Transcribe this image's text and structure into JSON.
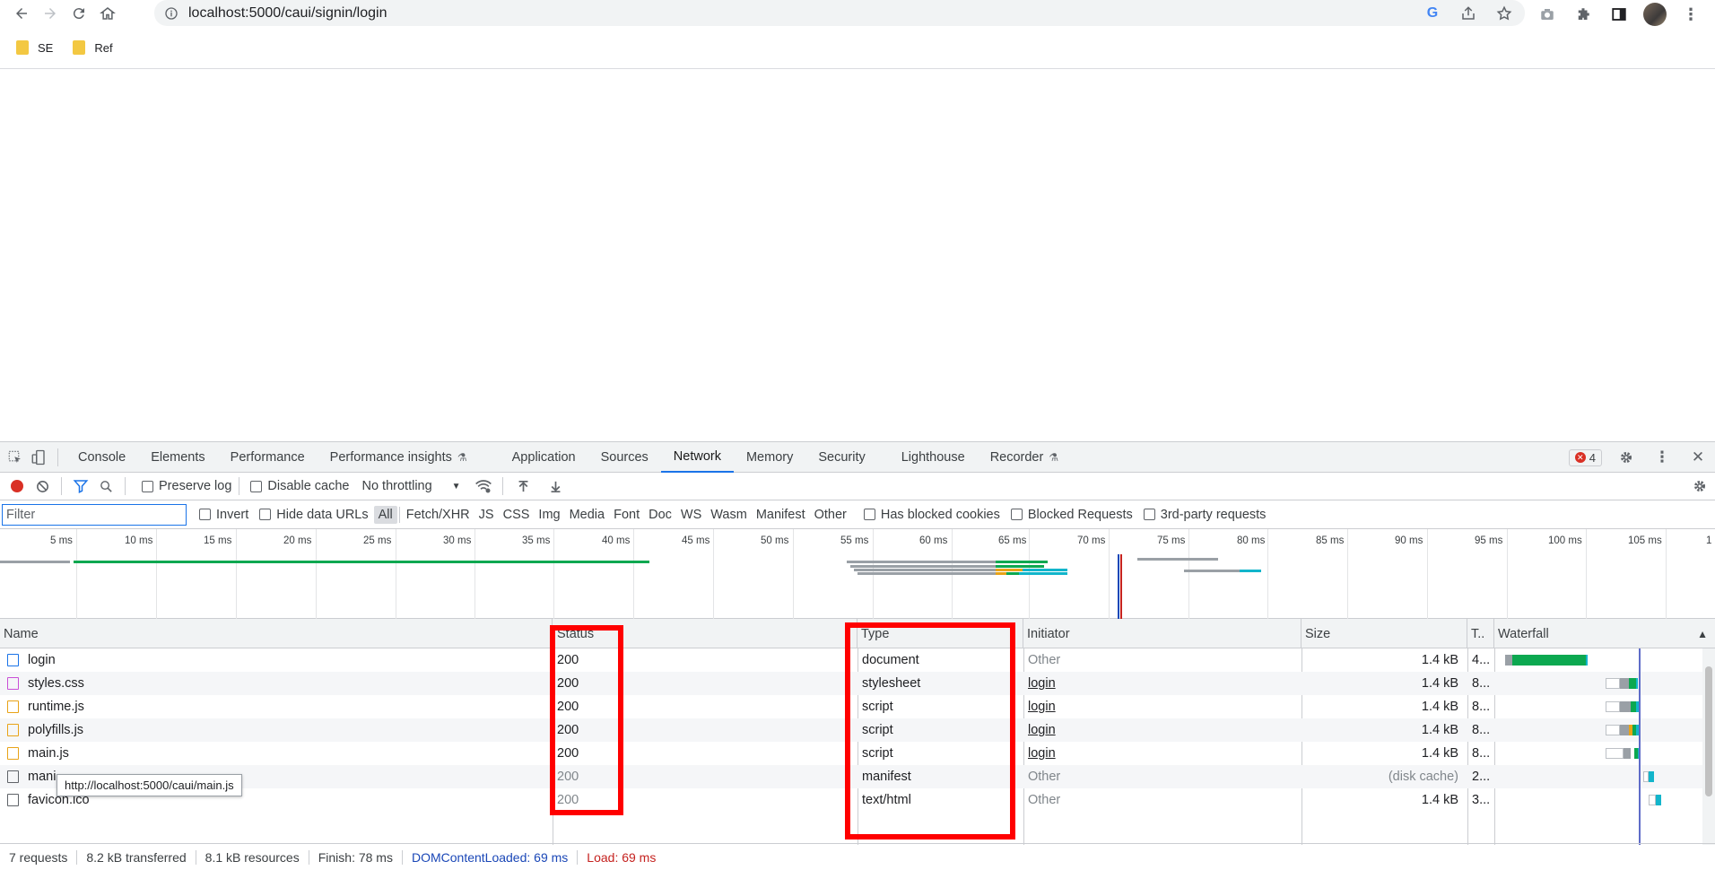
{
  "browser": {
    "url": "localhost:5000/caui/signin/login",
    "bookmarks": [
      "SE",
      "Ref"
    ]
  },
  "devtools": {
    "tabs": [
      "Console",
      "Elements",
      "Performance",
      "Performance insights",
      "Application",
      "Sources",
      "Network",
      "Memory",
      "Security",
      "Lighthouse",
      "Recorder"
    ],
    "active_tab": "Network",
    "error_count": "4",
    "toolbar": {
      "preserve_log": "Preserve log",
      "disable_cache": "Disable cache",
      "throttling": "No throttling"
    },
    "filter": {
      "placeholder": "Filter",
      "invert": "Invert",
      "hide_data_urls": "Hide data URLs",
      "types": [
        "All",
        "Fetch/XHR",
        "JS",
        "CSS",
        "Img",
        "Media",
        "Font",
        "Doc",
        "WS",
        "Wasm",
        "Manifest",
        "Other"
      ],
      "has_blocked_cookies": "Has blocked cookies",
      "blocked_requests": "Blocked Requests",
      "third_party": "3rd-party requests"
    },
    "overview_ticks": [
      "5 ms",
      "10 ms",
      "15 ms",
      "20 ms",
      "25 ms",
      "30 ms",
      "35 ms",
      "40 ms",
      "45 ms",
      "50 ms",
      "55 ms",
      "60 ms",
      "65 ms",
      "70 ms",
      "75 ms",
      "80 ms",
      "85 ms",
      "90 ms",
      "95 ms",
      "100 ms",
      "105 ms",
      "1"
    ],
    "columns": [
      "Name",
      "Status",
      "Type",
      "Initiator",
      "Size",
      "T..",
      "Waterfall"
    ],
    "requests": [
      {
        "name": "login",
        "status": "200",
        "type": "document",
        "initiator": "Other",
        "size": "1.4 kB",
        "time": "4...",
        "icon": "doc-icon"
      },
      {
        "name": "styles.css",
        "status": "200",
        "type": "stylesheet",
        "initiator": "login",
        "size": "1.4 kB",
        "time": "8...",
        "icon": "css-icon"
      },
      {
        "name": "runtime.js",
        "status": "200",
        "type": "script",
        "initiator": "login",
        "size": "1.4 kB",
        "time": "8...",
        "icon": "js-icon"
      },
      {
        "name": "polyfills.js",
        "status": "200",
        "type": "script",
        "initiator": "login",
        "size": "1.4 kB",
        "time": "8...",
        "icon": "js-icon"
      },
      {
        "name": "main.js",
        "status": "200",
        "type": "script",
        "initiator": "login",
        "size": "1.4 kB",
        "time": "8...",
        "icon": "js-icon"
      },
      {
        "name": "mani",
        "status": "200",
        "type": "manifest",
        "initiator": "Other",
        "size": "(disk cache)",
        "time": "2...",
        "icon": "file-icon"
      },
      {
        "name": "favicon.ico",
        "status": "200",
        "type": "text/html",
        "initiator": "Other",
        "size": "1.4 kB",
        "time": "3...",
        "icon": "file-icon"
      }
    ],
    "tooltip": "http://localhost:5000/caui/main.js",
    "status_bar": {
      "requests": "7 requests",
      "transferred": "8.2 kB transferred",
      "resources": "8.1 kB resources",
      "finish": "Finish: 78 ms",
      "dcl": "DOMContentLoaded: 69 ms",
      "load": "Load: 69 ms"
    }
  }
}
